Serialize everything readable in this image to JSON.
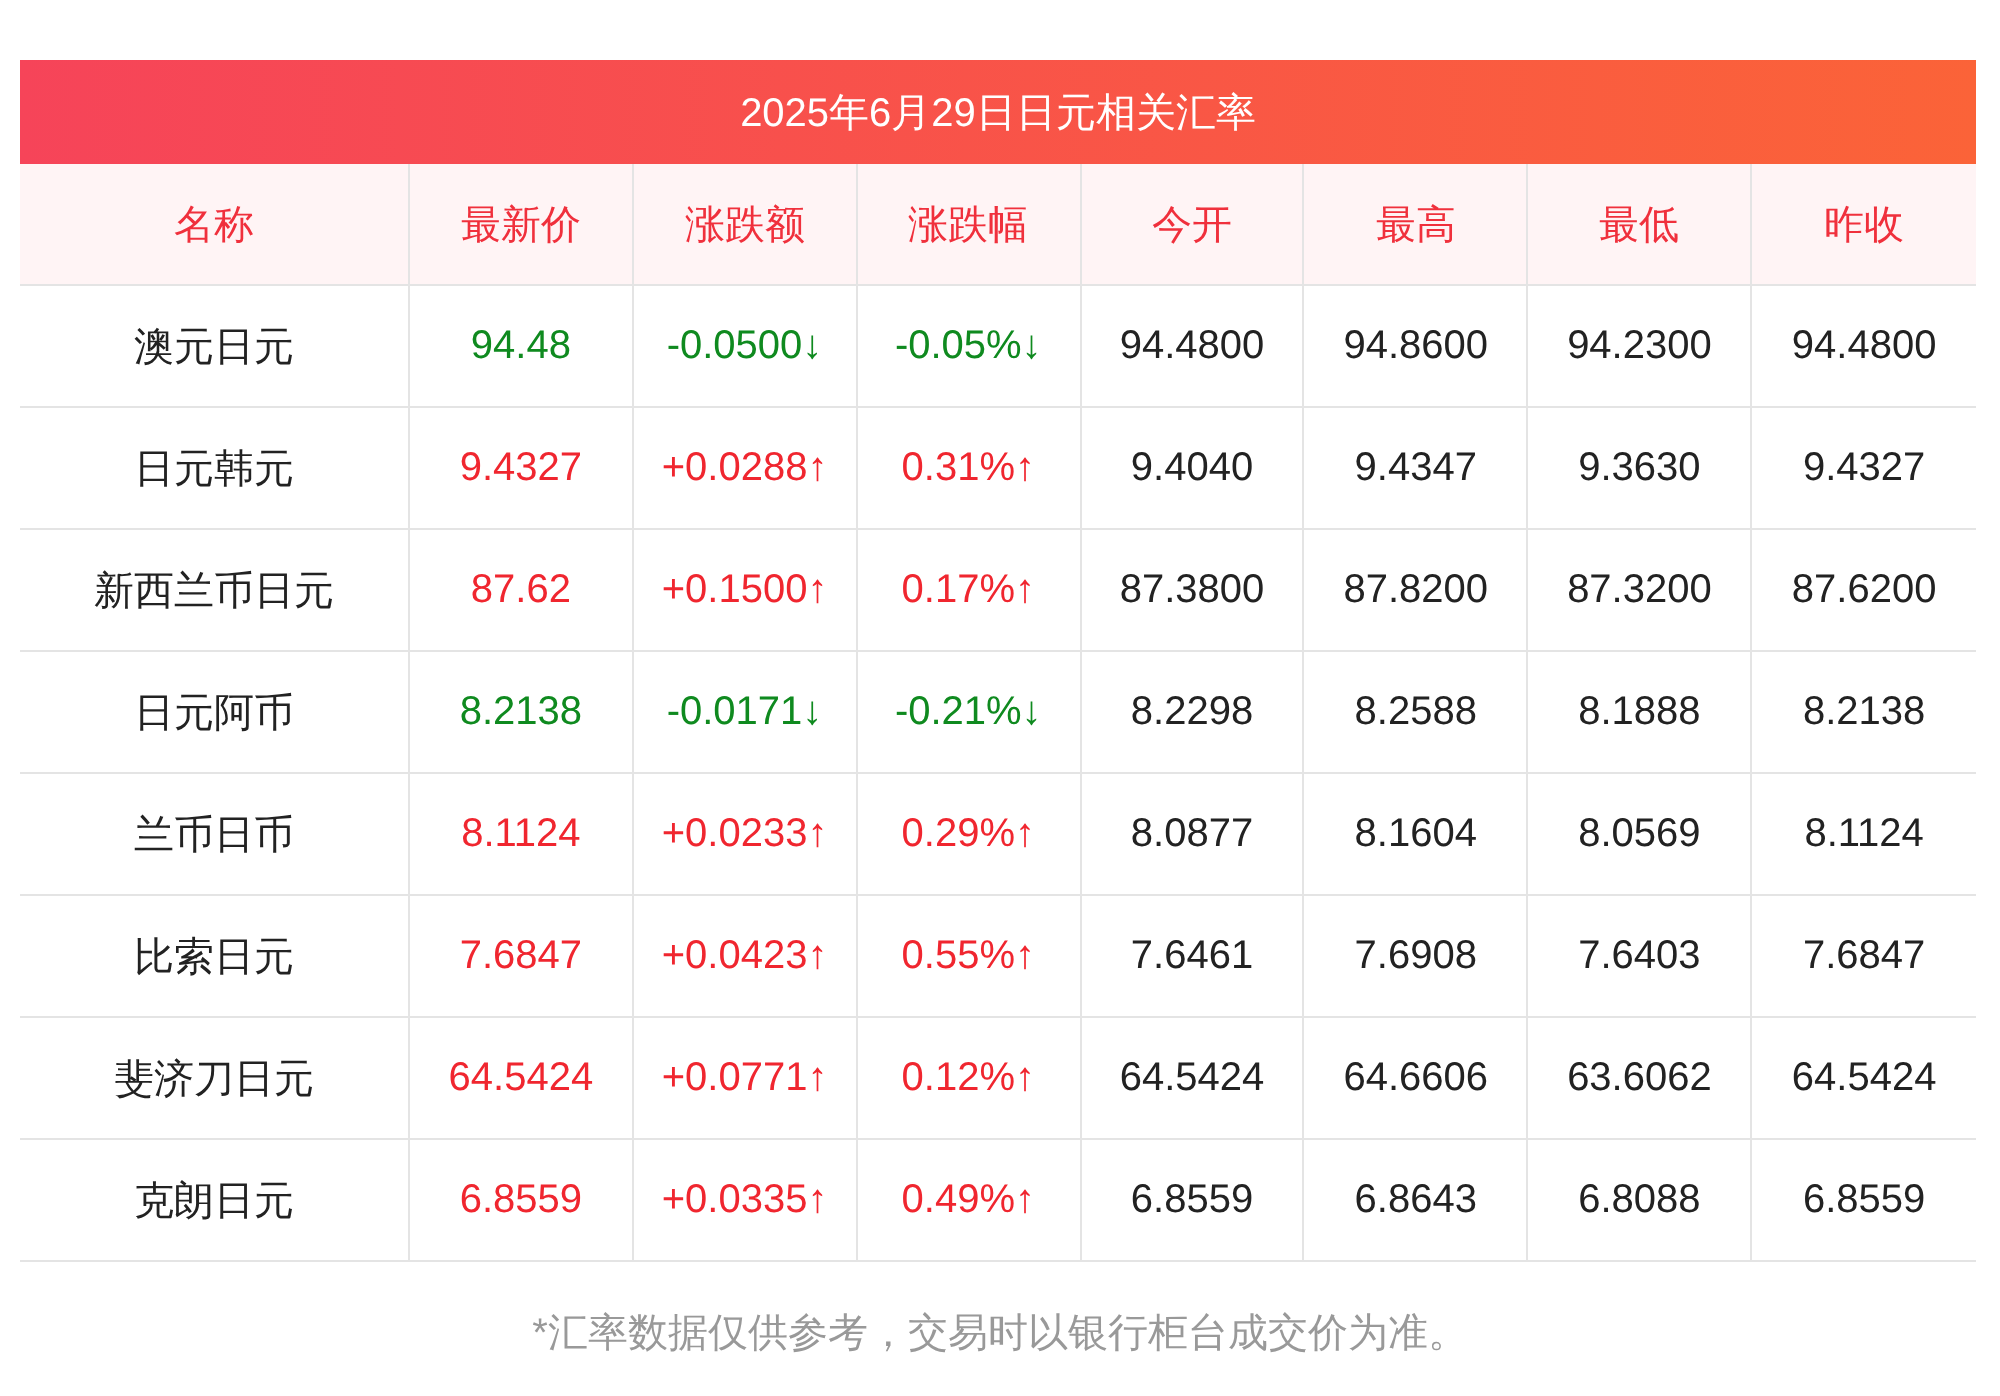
{
  "title": "2025年6月29日日元相关汇率",
  "columns": [
    "名称",
    "最新价",
    "涨跌额",
    "涨跌幅",
    "今开",
    "最高",
    "最低",
    "昨收"
  ],
  "rows": [
    {
      "rising": false,
      "cells": [
        "澳元日元",
        "94.48",
        "-0.0500↓",
        "-0.05%↓",
        "94.4800",
        "94.8600",
        "94.2300",
        "94.4800"
      ]
    },
    {
      "rising": true,
      "cells": [
        "日元韩元",
        "9.4327",
        "+0.0288↑",
        "0.31%↑",
        "9.4040",
        "9.4347",
        "9.3630",
        "9.4327"
      ]
    },
    {
      "rising": true,
      "cells": [
        "新西兰币日元",
        "87.62",
        "+0.1500↑",
        "0.17%↑",
        "87.3800",
        "87.8200",
        "87.3200",
        "87.6200"
      ]
    },
    {
      "rising": false,
      "cells": [
        "日元阿币",
        "8.2138",
        "-0.0171↓",
        "-0.21%↓",
        "8.2298",
        "8.2588",
        "8.1888",
        "8.2138"
      ]
    },
    {
      "rising": true,
      "cells": [
        "兰币日币",
        "8.1124",
        "+0.0233↑",
        "0.29%↑",
        "8.0877",
        "8.1604",
        "8.0569",
        "8.1124"
      ]
    },
    {
      "rising": true,
      "cells": [
        "比索日元",
        "7.6847",
        "+0.0423↑",
        "0.55%↑",
        "7.6461",
        "7.6908",
        "7.6403",
        "7.6847"
      ]
    },
    {
      "rising": true,
      "cells": [
        "斐济刀日元",
        "64.5424",
        "+0.0771↑",
        "0.12%↑",
        "64.5424",
        "64.6606",
        "63.6062",
        "64.5424"
      ]
    },
    {
      "rising": true,
      "cells": [
        "克朗日元",
        "6.8559",
        "+0.0335↑",
        "0.49%↑",
        "6.8559",
        "6.8643",
        "6.8088",
        "6.8559"
      ]
    }
  ],
  "footnote": "*汇率数据仅供参考，交易时以银行柜台成交价为准。"
}
